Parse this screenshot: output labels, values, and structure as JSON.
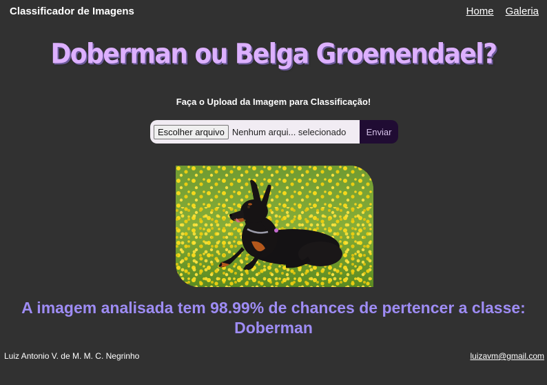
{
  "header": {
    "brand": "Classificador de Imagens",
    "nav": {
      "home": "Home",
      "gallery": "Galeria"
    }
  },
  "main": {
    "title": "Doberman ou Belga Groenendael?",
    "subtitle": "Faça o Upload da Imagem para Classificação!",
    "upload": {
      "choose_file_label": "Escolher arquivo",
      "file_status": "Nenhum arqui... selecionado",
      "submit_label": "Enviar"
    },
    "image": {
      "alt": "Doberman deitado em um campo de flores amarelas"
    },
    "result": {
      "line1": "A imagem analisada tem 98.99% de chances de pertencer a classe:",
      "line2": "Doberman"
    }
  },
  "footer": {
    "author": "Luiz Antonio V. de M. M. C. Negrinho",
    "email": "luizavm@gmail.com"
  },
  "colors": {
    "background": "#313131",
    "title": "#ddb0ff",
    "result": "#9e8cf4",
    "submit_bg": "#200c33"
  }
}
